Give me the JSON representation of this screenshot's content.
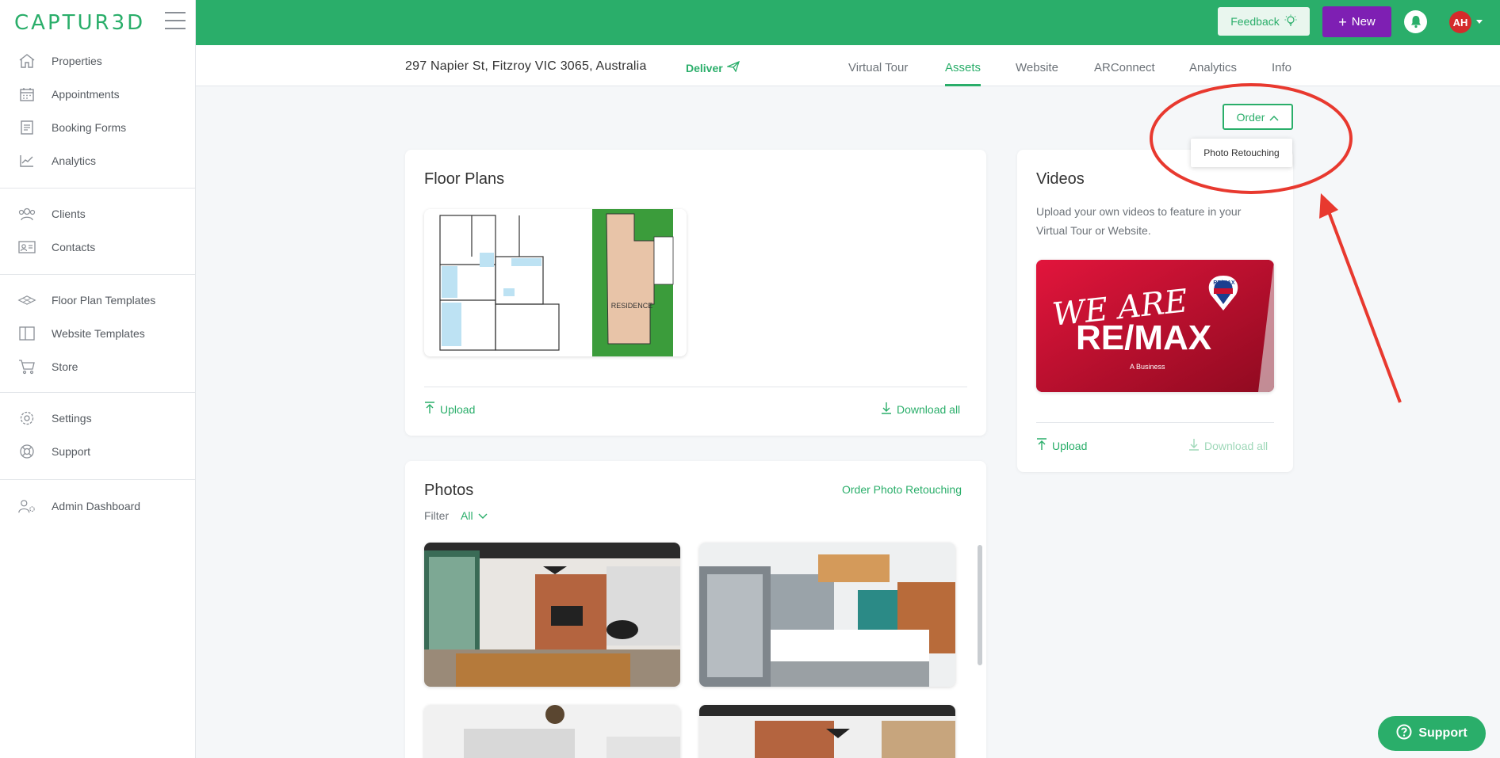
{
  "app": {
    "logo_text": "CAPTUR3D"
  },
  "sidebar": {
    "groups": [
      {
        "items": [
          {
            "label": "Properties",
            "icon": "home-icon"
          },
          {
            "label": "Appointments",
            "icon": "calendar-icon"
          },
          {
            "label": "Booking Forms",
            "icon": "form-icon"
          },
          {
            "label": "Analytics",
            "icon": "chart-icon"
          }
        ]
      },
      {
        "items": [
          {
            "label": "Clients",
            "icon": "users-icon"
          },
          {
            "label": "Contacts",
            "icon": "contact-card-icon"
          }
        ]
      },
      {
        "items": [
          {
            "label": "Floor Plan Templates",
            "icon": "layers-icon"
          },
          {
            "label": "Website Templates",
            "icon": "layout-icon"
          },
          {
            "label": "Store",
            "icon": "cart-icon"
          }
        ]
      },
      {
        "items": [
          {
            "label": "Settings",
            "icon": "gear-icon"
          },
          {
            "label": "Support",
            "icon": "lifebuoy-icon"
          }
        ]
      },
      {
        "items": [
          {
            "label": "Admin Dashboard",
            "icon": "admin-user-icon"
          }
        ]
      }
    ]
  },
  "topbar": {
    "feedback_label": "Feedback",
    "new_label": "New",
    "avatar_initials": "AH",
    "colors": {
      "bar": "#2aae6a",
      "new_button": "#7e1fb3",
      "avatar": "#d42b2b"
    }
  },
  "property": {
    "address": "297 Napier St, Fitzroy VIC 3065, Australia",
    "deliver_label": "Deliver"
  },
  "tabs": [
    {
      "label": "Virtual Tour",
      "active": false
    },
    {
      "label": "Assets",
      "active": true
    },
    {
      "label": "Website",
      "active": false
    },
    {
      "label": "ARConnect",
      "active": false
    },
    {
      "label": "Analytics",
      "active": false
    },
    {
      "label": "Info",
      "active": false
    }
  ],
  "order": {
    "label": "Order",
    "menu_items": [
      "Photo Retouching"
    ]
  },
  "floor_plans": {
    "title": "Floor Plans",
    "upload_label": "Upload",
    "download_label": "Download all",
    "plan_text": "RESIDENCE"
  },
  "videos": {
    "title": "Videos",
    "description": "Upload your own videos to feature in your Virtual Tour or Website.",
    "video_line1": "WE ARE",
    "video_line2": "RE/MAX",
    "video_sub": "A Business",
    "badge": "RE/MAX",
    "upload_label": "Upload",
    "download_label": "Download all"
  },
  "photos": {
    "title": "Photos",
    "order_link": "Order Photo Retouching",
    "filter_label": "Filter",
    "filter_value": "All"
  },
  "support_widget": {
    "label": "Support"
  }
}
